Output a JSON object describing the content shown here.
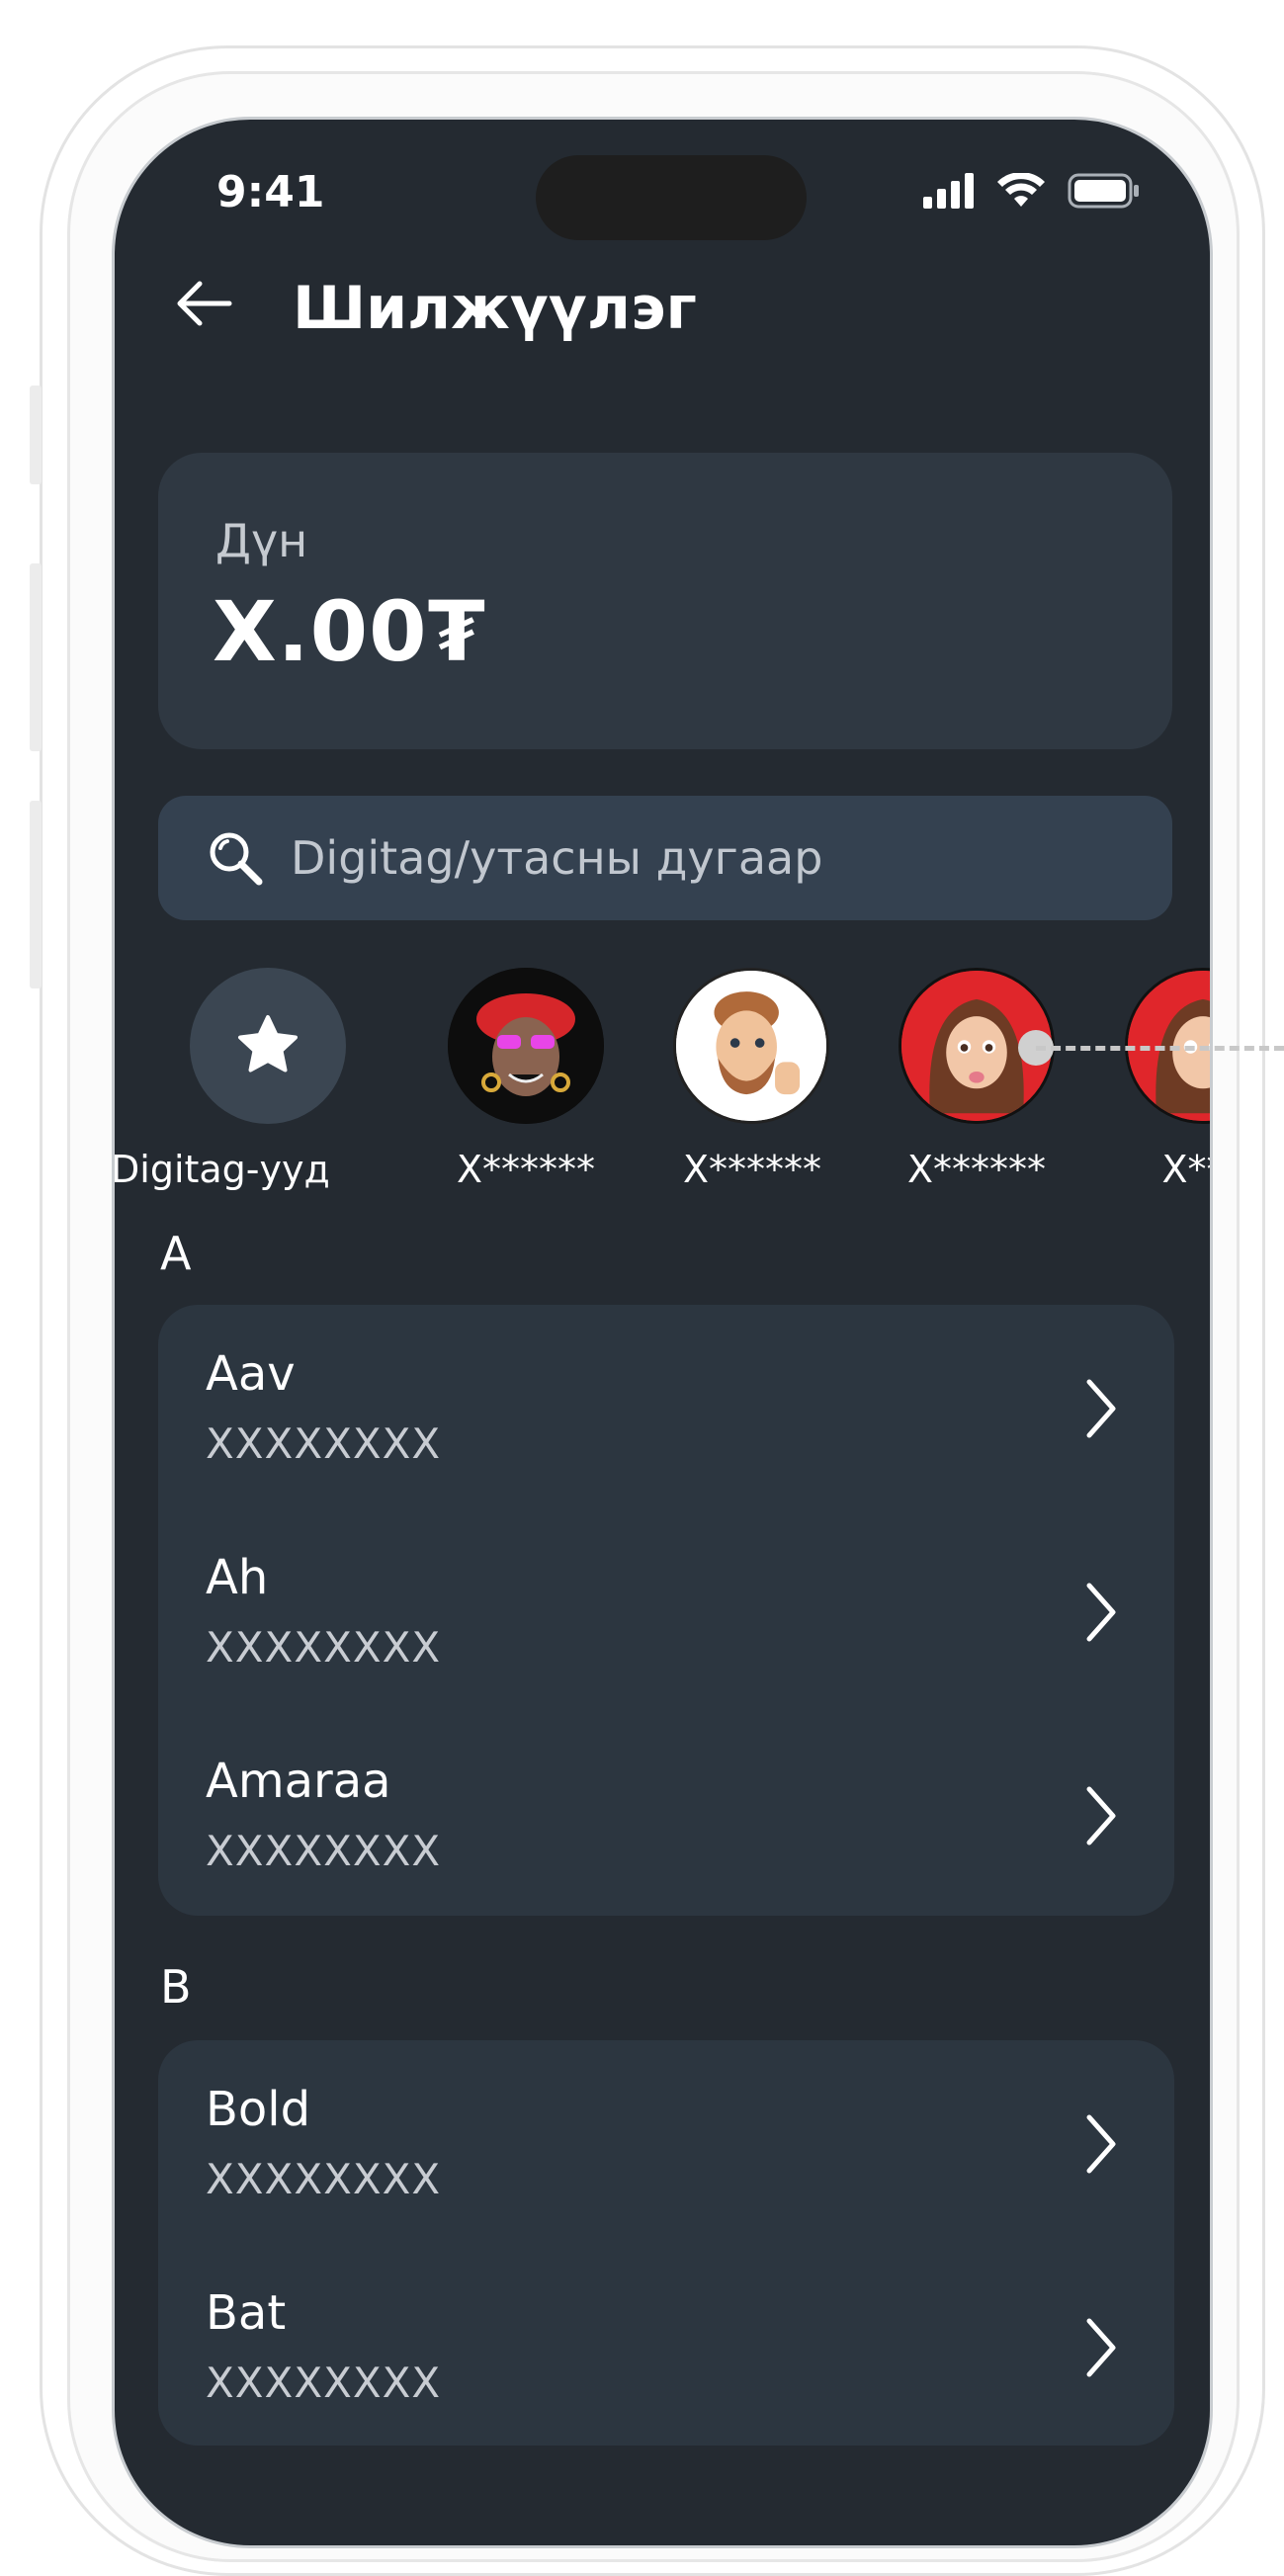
{
  "status_bar": {
    "time": "9:41"
  },
  "header": {
    "title": "Шилжүүлэг"
  },
  "amount": {
    "label": "Дүн",
    "value": "X.00₮"
  },
  "search": {
    "placeholder": "Digitag/утасны дугаар"
  },
  "contacts": [
    {
      "name": "Digitag-ууд"
    },
    {
      "name": "X******"
    },
    {
      "name": "X******"
    },
    {
      "name": "X******"
    },
    {
      "name": "X***"
    }
  ],
  "sections": [
    {
      "letter": "A",
      "items": [
        {
          "name": "Aav",
          "number": "XXXXXXXX"
        },
        {
          "name": "Ah",
          "number": "XXXXXXXX"
        },
        {
          "name": "Amaraa",
          "number": "XXXXXXXX"
        }
      ]
    },
    {
      "letter": "B",
      "items": [
        {
          "name": "Bold",
          "number": "XXXXXXXX"
        },
        {
          "name": "Bat",
          "number": "XXXXXXXX"
        }
      ]
    }
  ],
  "colors": {
    "background": "#242a31",
    "card": "#2c3640",
    "search": "#344150",
    "accent_red": "#e0262b"
  },
  "icons": [
    "back-arrow-icon",
    "search-icon",
    "star-icon",
    "chevron-right-icon",
    "signal-icon",
    "wifi-icon",
    "battery-icon"
  ]
}
